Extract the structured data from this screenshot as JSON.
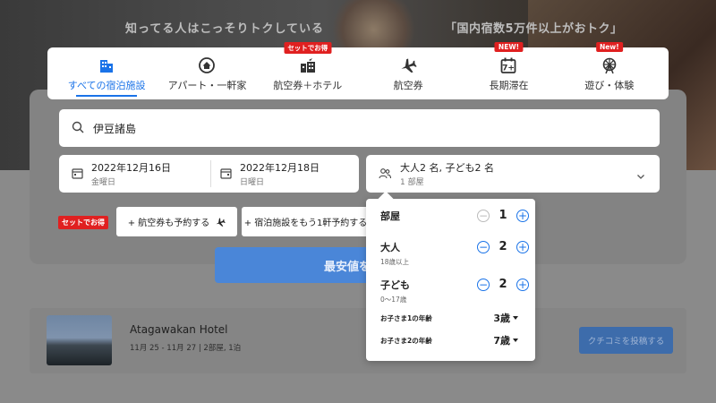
{
  "hero": {
    "tagline_left": "知ってる人はこっそりトクしている",
    "tagline_right": "「国内宿数5万件以上がおトク」"
  },
  "tabs": [
    {
      "label": "すべての宿泊施設",
      "icon": "building-icon",
      "active": true,
      "badge": ""
    },
    {
      "label": "アパート・一軒家",
      "icon": "house-icon",
      "active": false,
      "badge": ""
    },
    {
      "label": "航空券＋ホテル",
      "icon": "flight-hotel-icon",
      "active": false,
      "badge": "セットでお得"
    },
    {
      "label": "航空券",
      "icon": "airplane-icon",
      "active": false,
      "badge": ""
    },
    {
      "label": "長期滞在",
      "icon": "calendar-7-icon",
      "active": false,
      "badge": "NEW!"
    },
    {
      "label": "遊び・体験",
      "icon": "ferris-wheel-icon",
      "active": false,
      "badge": "New!"
    }
  ],
  "search": {
    "destination": "伊豆諸島",
    "checkin_date": "2022年12月16日",
    "checkin_day": "金曜日",
    "checkout_date": "2022年12月18日",
    "checkout_day": "日曜日",
    "guests_summary": "大人2 名, 子ども2 名",
    "rooms_summary": "1 部屋",
    "set_badge": "セットでお得",
    "add_flight": "+ 航空券も予約する",
    "add_stay": "+ 宿泊施設をもう1軒予約する",
    "search_button": "最安値を"
  },
  "guest_popup": {
    "rooms_label": "部屋",
    "rooms_count": "1",
    "adults_label": "大人",
    "adults_sub": "18歳以上",
    "adults_count": "2",
    "children_label": "子ども",
    "children_sub": "0～17歳",
    "children_count": "2",
    "child1_label": "お子さま1の年齢",
    "child1_age": "3歳",
    "child2_label": "お子さま2の年齢",
    "child2_age": "7歳"
  },
  "recent": {
    "hotel_name": "Atagawakan Hotel",
    "hotel_meta": "11月 25 - 11月 27 | 2部屋, 1泊",
    "review_button": "クチコミを投稿する"
  },
  "colors": {
    "accent": "#1a73e8",
    "badge_red": "#e02020",
    "search_button": "#4a86d8"
  }
}
